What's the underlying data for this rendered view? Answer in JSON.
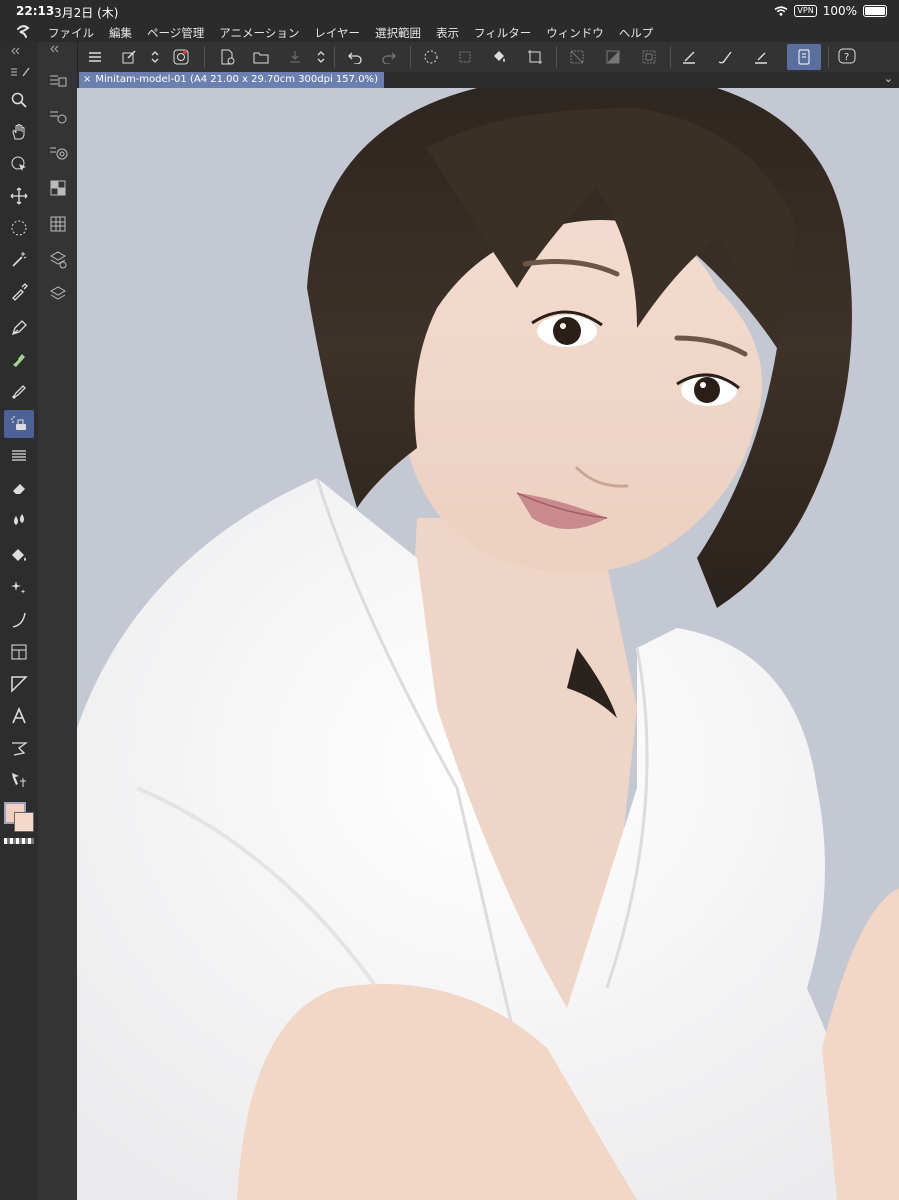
{
  "status_bar": {
    "time": "22:13",
    "date": "3月2日 (木)",
    "battery": "100%",
    "vpn": "VPN"
  },
  "menu": {
    "items": [
      "ファイル",
      "編集",
      "ページ管理",
      "アニメーション",
      "レイヤー",
      "選択範囲",
      "表示",
      "フィルター",
      "ウィンドウ",
      "ヘルプ"
    ]
  },
  "canvas_tab": {
    "title": "Minitam-model-01 (A4 21.00 x 29.70cm 300dpi 157.0%)"
  },
  "colors": {
    "main_color": "#f3cfc0",
    "sub_color": "#f6d8c8",
    "background": "#c3c8d3"
  }
}
